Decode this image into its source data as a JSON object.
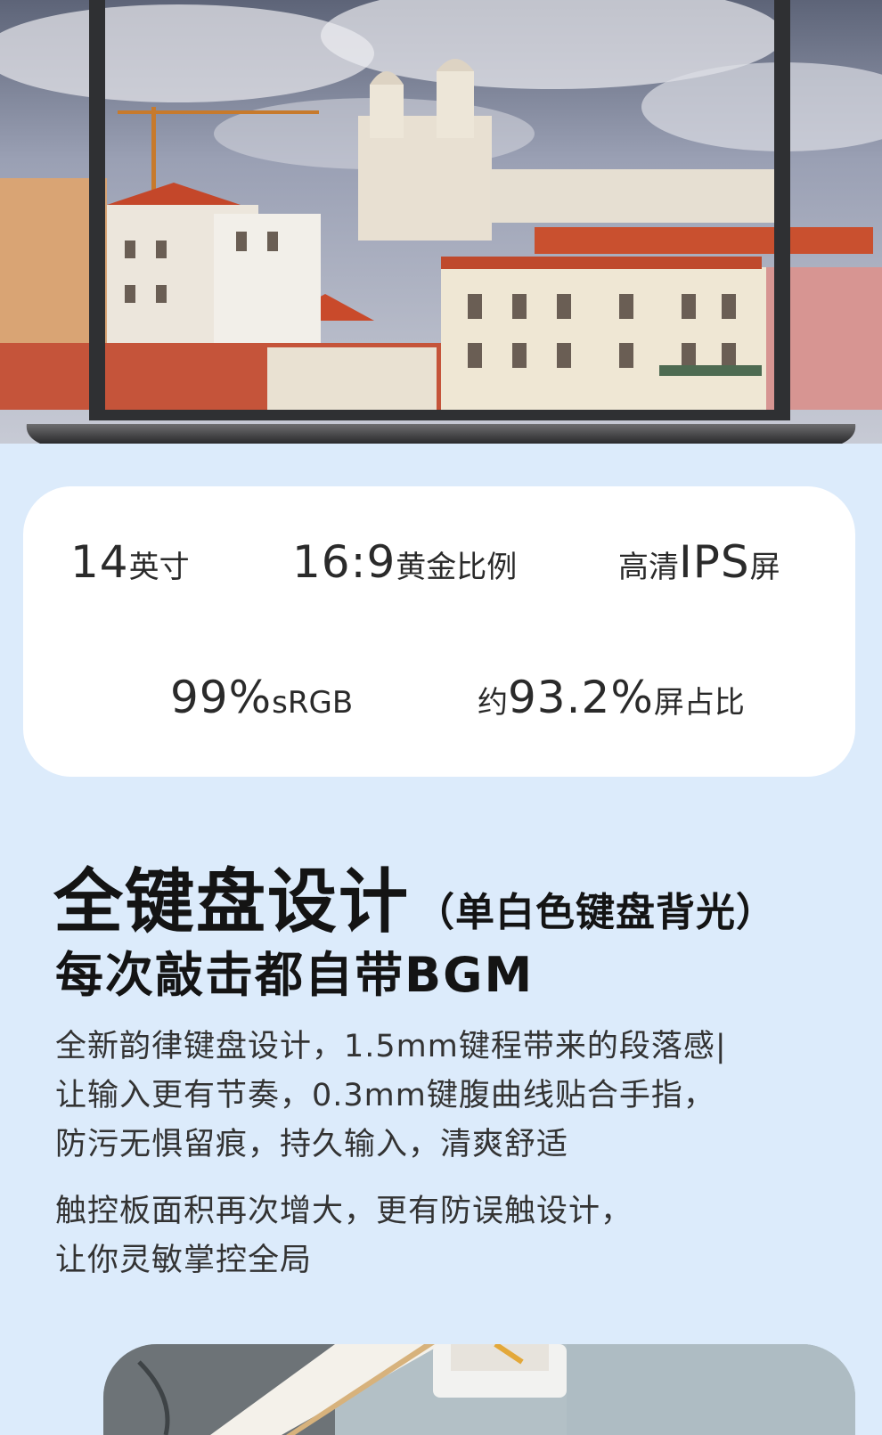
{
  "specs": {
    "size": {
      "number": "14",
      "unit": "英寸"
    },
    "ratio": {
      "number": "16:9",
      "label": "黄金比例"
    },
    "panel": {
      "prefix": "高清",
      "number": "IPS",
      "suffix": "屏"
    },
    "gamut": {
      "number": "99%",
      "unit": "sRGB"
    },
    "screen_ratio": {
      "prefix": "约",
      "number": "93.2%",
      "suffix": "屏占比"
    }
  },
  "keyboard": {
    "title": "全键盘设计",
    "title_note": "（单白色键盘背光）",
    "subtitle": "每次敲击都自带BGM",
    "paragraph1": [
      "全新韵律键盘设计，1.5mm键程带来的段落感|",
      "让输入更有节奏，0.3mm键腹曲线贴合手指，",
      "防污无惧留痕，持久输入，清爽舒适"
    ],
    "paragraph2": [
      "触控板面积再次增大，更有防误触设计，",
      "让你灵敏掌控全局"
    ]
  },
  "colors": {
    "background": "#dcebfb",
    "card": "#ffffff",
    "text": "#1c1c1c"
  }
}
